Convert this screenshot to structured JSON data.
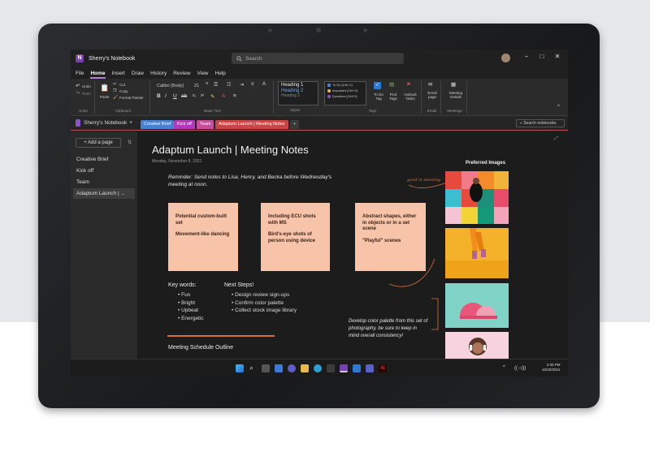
{
  "window": {
    "app_title": "Sherry's Notebook",
    "search_placeholder": "Search",
    "minimize": "−",
    "maximize": "□",
    "close": "✕"
  },
  "menu": [
    "File",
    "Home",
    "Insert",
    "Draw",
    "History",
    "Review",
    "View",
    "Help"
  ],
  "menu_active": "Home",
  "ribbon": {
    "undo": "Undo",
    "redo": "Redo",
    "paste": "Paste",
    "cut": "Cut",
    "copy": "Copy",
    "format_painter": "Format Painter",
    "font_name": "Calibri (Body)",
    "font_size": "21",
    "styles": [
      "Heading 1",
      "Heading 2",
      "Heading 3"
    ],
    "tags": [
      "To Do (Ctrl+1)",
      "Important (Ctrl+2)",
      "Question (Ctrl+3)"
    ],
    "todo_tag": "To Do Tag",
    "find_tags": "Find Tags",
    "outlook_tasks": "Outlook Tasks",
    "email_page": "Email page",
    "meeting_details": "Meeting Details",
    "groups": [
      "Undo",
      "Clipboard",
      "Basic Text",
      "Styles",
      "Tags",
      "Email",
      "Meetings"
    ]
  },
  "tabs": {
    "notebook": "Sherry's Notebook",
    "sections": [
      {
        "label": "Creative Brief",
        "color": "#4a7fd0"
      },
      {
        "label": "Kick off",
        "color": "#b23ab8"
      },
      {
        "label": "Team",
        "color": "#c64f9d"
      },
      {
        "label": "Adaptum Launch | Meeting Notes",
        "color": "#c94646"
      }
    ],
    "add": "+",
    "search_notebooks": "Search notebooks"
  },
  "sidebar": {
    "add_page": "+ Add a page",
    "pages": [
      "Creative Brief",
      "Kick off",
      "Team",
      "Adaptum Launch | ..."
    ],
    "selected_index": 3
  },
  "page": {
    "title": "Adaptum Launch | Meeting Notes",
    "date": "Monday, November 8, 2021",
    "reminder": "Reminder: Send notes to Lisa, Henry, and Becka before Wednesday's meeting at noon.",
    "handwriting": "good in meeting",
    "stickies": [
      [
        "Potential custom-built set",
        "Movement-like dancing"
      ],
      [
        "Including ECU shots with MS",
        "Bird's-eye shots of person using device"
      ],
      [
        "Abstract shapes, either in objects or in a set scene",
        "\"Playful\" scenes"
      ]
    ],
    "keywords_title": "Key words:",
    "keywords": [
      "Fun",
      "Bright",
      "Upbeat",
      "Energetic"
    ],
    "next_steps_title": "Next Steps!",
    "next_steps": [
      "Design review sign-ups",
      "Confirm color palette",
      "Collect stock image library"
    ],
    "schedule_title": "Meeting Schedule Outline",
    "develop_note": "Develop color palette from this set of photography, be sure to keep in mind overall consistency!",
    "preferred_images_title": "Preferred Images"
  },
  "taskbar": {
    "time": "2:30 PM",
    "date": "10/20/2021",
    "chevron": "^",
    "tray_icons": "(( ◁))"
  },
  "colors": {
    "accent": "#b67de0",
    "section_underline": "#c14f4f",
    "sticky": "#f7c3a9",
    "divider": "#d8703c"
  }
}
